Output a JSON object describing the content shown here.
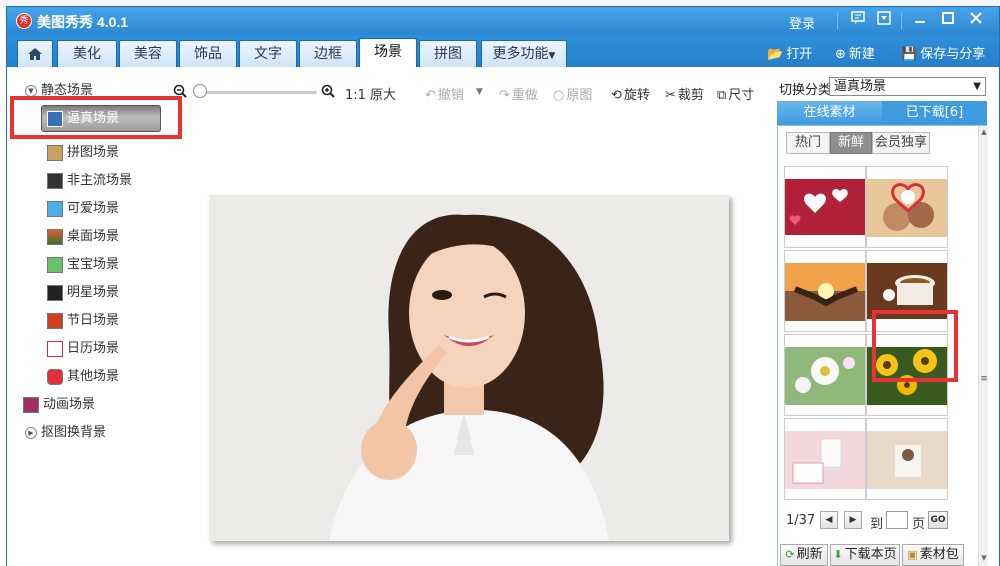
{
  "app": {
    "title": "美图秀秀 4.0.1",
    "logo_text": "秀"
  },
  "titlebar": {
    "login": "登录",
    "icons": [
      "message-icon",
      "menu-icon",
      "minimize-icon",
      "maximize-icon",
      "close-icon"
    ]
  },
  "nav": {
    "tabs": [
      "美化",
      "美容",
      "饰品",
      "文字",
      "边框",
      "场景",
      "拼图",
      "更多功能"
    ],
    "active_tab": "场景",
    "open_label": "打开",
    "new_label": "新建",
    "save_label": "保存与分享"
  },
  "tree": {
    "static_group": "静态场景",
    "selected_item": "逼真场景",
    "items": [
      "拼图场景",
      "非主流场景",
      "可爱场景",
      "桌面场景",
      "宝宝场景",
      "明星场景",
      "节日场景",
      "日历场景",
      "其他场景"
    ],
    "animated_group": "动画场景",
    "cutout_group": "抠图换背景"
  },
  "toolbar": {
    "original_size": "1:1 原大",
    "undo": "撤销",
    "redo": "重做",
    "original": "原图",
    "rotate": "旋转",
    "crop": "裁剪",
    "size": "尺寸",
    "zoom_level": 0.0
  },
  "right_panel": {
    "category_label": "切换分类",
    "category_value": "逼真场景",
    "tab_online": "在线素材",
    "tab_downloaded": "已下载[6]",
    "subtabs": [
      "热门",
      "新鲜",
      "会员独享"
    ],
    "active_subtab": "新鲜",
    "thumbnails": [
      "heart-cards",
      "heart-frame-couple",
      "sunset-hands-heart",
      "coffee-cup",
      "white-flowers",
      "sunflowers",
      "cup-on-table",
      "portrait-blur"
    ],
    "page_current": "1/37",
    "page_to": "到",
    "page_unit": "页",
    "go_label": "GO",
    "refresh_label": "刷新",
    "download_page_label": "下载本页",
    "material_pack_label": "素材包"
  },
  "colors": {
    "titlebar": "#2a87d3",
    "highlight_box": "#e63434",
    "panel_tab": "#3e9be0"
  }
}
